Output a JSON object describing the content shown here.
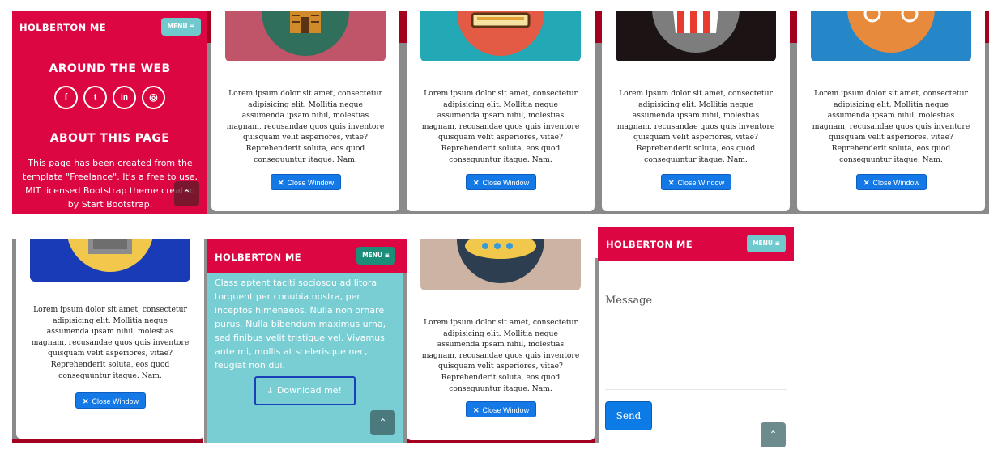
{
  "colors": {
    "brand_red": "#dc0742",
    "crimson_bg": "#a3001f",
    "gray_bg": "#8f8f8f",
    "teal": "#79ced4",
    "blue_button": "#1479e6",
    "menu_teal": "#6fc9cd",
    "menu_green": "#1b8e7a"
  },
  "brand": "HOLBERTON ME",
  "menu_label": "MENU ≡",
  "lorem": "Lorem ipsum dolor sit amet, consectetur adipisicing elit. Mollitia neque assumenda ipsam nihil, molestias magnam, recusandae quos quis inventore quisquam velit asperiores, vitae? Reprehenderit soluta, eos quod consequuntur itaque. Nam.",
  "close_label": "Close Window",
  "footer": {
    "around_title": "AROUND THE WEB",
    "about_title": "ABOUT THIS PAGE",
    "about_text": "This page has been created from the template \"Freelance\". It's a free to use, MIT licensed Bootstrap theme created by Start Bootstrap.",
    "social_icons": [
      "facebook-icon",
      "twitter-icon",
      "linkedin-icon",
      "dribbble-icon"
    ],
    "social_glyphs": [
      "f",
      "t",
      "in",
      "◎"
    ]
  },
  "teal_panel": {
    "text": "Class aptent taciti sociosqu ad litora torquent per conubia nostra, per inceptos himenaeos. Nulla non ornare purus. Nulla bibendum maximus urna, sed finibus velit tristique vel. Vivamus ante mi, mollis at scelerisque nec, feugiat non dui.",
    "download_label": "Download me!"
  },
  "contact": {
    "message_placeholder": "Message",
    "send_label": "Send"
  },
  "scroll_top_glyph": "⌃"
}
